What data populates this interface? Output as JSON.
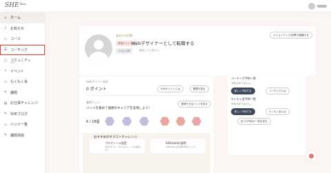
{
  "app": {
    "logo_text": "SHE",
    "logo_suffix": "likes"
  },
  "header": {
    "avatar_icon": "user-avatar"
  },
  "colors": {
    "accent": "#a6896d",
    "badge_bg": "#f8e6e2",
    "dark_button": "#3e4a5c",
    "highlight": "#e53935"
  },
  "sidebar": {
    "items": [
      {
        "label": "ホーム",
        "icon": "home-icon",
        "glyph": "⌂",
        "active": true
      },
      {
        "label": "お知らせ",
        "icon": "bell-icon",
        "glyph": "♪"
      },
      {
        "label": "コース",
        "icon": "book-icon",
        "glyph": "▭"
      },
      {
        "label": "コーチング",
        "icon": "coaching-icon",
        "glyph": "☰",
        "highlight": true
      },
      {
        "label": "コミュニティ",
        "icon": "chat-icon",
        "glyph": "▢",
        "sub": "Slack"
      },
      {
        "label": "イベント",
        "icon": "sparkle-icon",
        "glyph": "✧"
      },
      {
        "label": "もくもく会",
        "icon": "laptop-icon",
        "glyph": "▭"
      },
      {
        "label": "課題",
        "icon": "pencil-icon",
        "glyph": "✎"
      },
      {
        "label": "お仕事チャレンジ",
        "icon": "clipboard-icon",
        "glyph": "▤"
      },
      {
        "label": "SHEブログ",
        "icon": "blog-icon",
        "glyph": "✎"
      },
      {
        "label": "バッジ一覧",
        "icon": "badge-icon",
        "glyph": "◇"
      },
      {
        "label": "課題添削",
        "icon": "check-icon",
        "glyph": "✎"
      }
    ]
  },
  "hero": {
    "section_label": "あなたの目標",
    "career_badge": "理想のキャリア",
    "goal_text": "Webデザイナーとして転職する",
    "current_badge": "今月の目標",
    "current_text": "設定していません。",
    "edit_button": "ビジョンマップ(目標)を編集する"
  },
  "points": {
    "label": "SHEポイント合計",
    "value": "0 ポイント",
    "about_button": "SHEポイントとは",
    "history_button": "履歴を見る"
  },
  "badges": {
    "label": "獲得バッジ",
    "headline": "バッジを集めて理想のキャリアを実現しよう！",
    "count": "6 / 18個",
    "list_button": "獲得できるバッジを探す",
    "icons": [
      "hex-badge-html",
      "hex-badge-css",
      "hex-badge-js",
      "hex-badge-figma",
      "hex-badge-pink-1",
      "hex-badge-pink-2",
      "hex-badge-pink-3"
    ]
  },
  "next": {
    "title": "おすすめのネクストチャレンジ",
    "card1_title": "プロフィール設定",
    "card1_text": "SHEプロフィールのプロフィールを設定しよう",
    "card2_title": "SHEstation説明",
    "card2_text": "SHEstationの活用方法をチェック"
  },
  "coaching_plan": {
    "title": "コーチング予約一覧",
    "empty_text": "予約がありません。",
    "new_button": "新しく予約する",
    "list_button": "コーチングとは",
    "mokumoku_title": "もくもく会予約一覧",
    "mokumoku_empty": "予約がありません。",
    "mokumoku_new": "新しく予約する",
    "mokumoku_about": "もくもく会とは",
    "all_button": "全ての予約の一覧を見る"
  }
}
